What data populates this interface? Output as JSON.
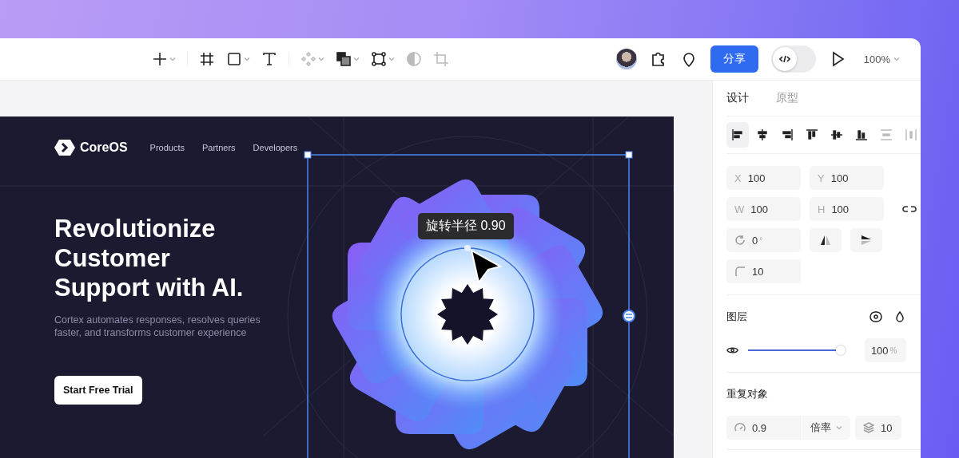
{
  "toolbar": {
    "tool_groups": [
      [
        {
          "kind": "add",
          "dropdown": true,
          "disabled": false
        }
      ],
      [
        {
          "kind": "frame",
          "dropdown": false,
          "disabled": false
        },
        {
          "kind": "rectangle",
          "dropdown": true,
          "disabled": false
        },
        {
          "kind": "text",
          "dropdown": false,
          "disabled": false
        }
      ],
      [
        {
          "kind": "component",
          "dropdown": true,
          "disabled": true
        },
        {
          "kind": "boolean",
          "dropdown": true,
          "disabled": false
        },
        {
          "kind": "path",
          "dropdown": true,
          "disabled": false
        },
        {
          "kind": "mask",
          "dropdown": false,
          "disabled": true
        },
        {
          "kind": "crop",
          "dropdown": false,
          "disabled": true
        }
      ]
    ],
    "share_button": "分享",
    "code_toggle": {
      "on": false
    },
    "zoom": "100%"
  },
  "canvas": {
    "site": {
      "logo": "CoreOS",
      "nav": [
        "Products",
        "Partners",
        "Developers"
      ],
      "headline": "Revolutionize Customer Support with AI.",
      "subtitle": "Cortex automates responses, resolves queries faster, and transforms customer experience",
      "cta": "Start Free Trial"
    },
    "tooltip": "旋转半径 0.90"
  },
  "panel": {
    "tabs": [
      {
        "label": "设计",
        "selected": true
      },
      {
        "label": "原型",
        "selected": false
      }
    ],
    "align": [
      {
        "kind": "left",
        "selected": true,
        "disabled": false
      },
      {
        "kind": "h-center",
        "selected": false,
        "disabled": false
      },
      {
        "kind": "right",
        "selected": false,
        "disabled": false
      },
      {
        "kind": "top",
        "selected": false,
        "disabled": false
      },
      {
        "kind": "v-center",
        "selected": false,
        "disabled": false
      },
      {
        "kind": "bottom",
        "selected": false,
        "disabled": false
      },
      {
        "kind": "distribute-v",
        "selected": false,
        "disabled": true
      },
      {
        "kind": "distribute-h",
        "selected": false,
        "disabled": true
      }
    ],
    "position": [
      {
        "label": "X",
        "value": "100"
      },
      {
        "label": "Y",
        "value": "100"
      }
    ],
    "size": [
      {
        "label": "W",
        "value": "100"
      },
      {
        "label": "H",
        "value": "100"
      }
    ],
    "rotation": {
      "value": "0",
      "unit": "°"
    },
    "corner_radius": "10",
    "layer": {
      "title": "图层",
      "opacity": {
        "level": 1,
        "value": "100",
        "unit": "%"
      }
    },
    "repeat": {
      "title": "重复对象",
      "radius": "0.9",
      "mode": "倍率",
      "count": "10"
    }
  }
}
